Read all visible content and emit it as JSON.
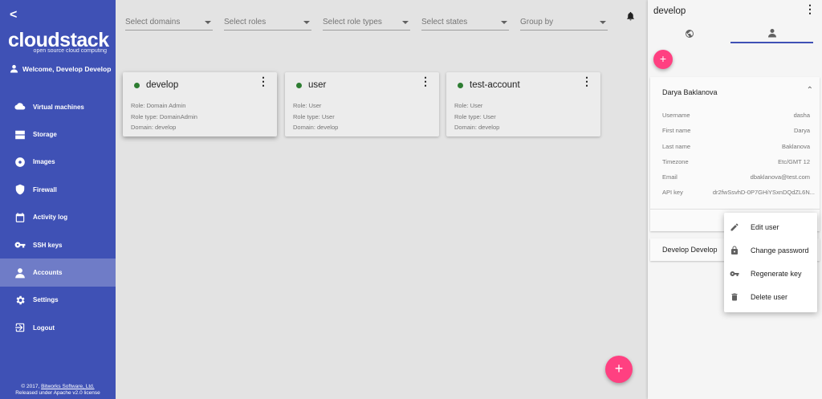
{
  "sidebar": {
    "logo_text": "cloudstack",
    "logo_tagline": "open source cloud computing",
    "welcome": "Welcome, Develop Develop",
    "items": [
      {
        "label": "Virtual machines",
        "icon": "cloud-icon"
      },
      {
        "label": "Storage",
        "icon": "storage-icon"
      },
      {
        "label": "Images",
        "icon": "disc-icon"
      },
      {
        "label": "Firewall",
        "icon": "shield-icon"
      },
      {
        "label": "Activity log",
        "icon": "calendar-icon"
      },
      {
        "label": "SSH keys",
        "icon": "key-icon"
      },
      {
        "label": "Accounts",
        "icon": "person-icon",
        "active": true
      },
      {
        "label": "Settings",
        "icon": "gear-icon"
      },
      {
        "label": "Logout",
        "icon": "logout-icon"
      }
    ],
    "footer_line1_prefix": "© 2017, ",
    "footer_company": "Bitworks Software, Ltd.",
    "footer_line2": "Released under Apache v2.0 license"
  },
  "filters": {
    "domains": "Select domains",
    "roles": "Select roles",
    "role_types": "Select role types",
    "states": "Select states",
    "group_by": "Group by"
  },
  "cards": [
    {
      "name": "develop",
      "role": "Role: Domain Admin",
      "role_type": "Role type: DomainAdmin",
      "domain": "Domain: develop",
      "status_color": "#2e7d32"
    },
    {
      "name": "user",
      "role": "Role: User",
      "role_type": "Role type: User",
      "domain": "Domain: develop",
      "status_color": "#2e7d32"
    },
    {
      "name": "test-account",
      "role": "Role: User",
      "role_type": "Role type: User",
      "domain": "Domain: develop",
      "status_color": "#2e7d32"
    }
  ],
  "fab_label": "+",
  "panel": {
    "title": "develop",
    "tabs": [
      {
        "icon": "globe-icon"
      },
      {
        "icon": "person-icon",
        "active": true
      }
    ],
    "add_label": "+",
    "user": {
      "full_name": "Darya Baklanova",
      "fields": [
        {
          "label": "Username",
          "value": "dasha"
        },
        {
          "label": "First name",
          "value": "Darya"
        },
        {
          "label": "Last name",
          "value": "Baklanova"
        },
        {
          "label": "Timezone",
          "value": "Etc/GMT 12"
        },
        {
          "label": "Email",
          "value": "dbaklanova@test.com"
        },
        {
          "label": "API key",
          "value": "dr2fwSsvhD-0P7GHiYSxnDQdZL6N..."
        }
      ]
    },
    "second_user": "Develop Develop"
  },
  "context_menu": [
    {
      "label": "Edit user",
      "icon": "pencil-icon"
    },
    {
      "label": "Change password",
      "icon": "lock-icon"
    },
    {
      "label": "Regenerate key",
      "icon": "key-icon"
    },
    {
      "label": "Delete user",
      "icon": "trash-icon"
    }
  ],
  "colors": {
    "primary": "#3f51b5",
    "accent": "#ff4081",
    "active_status": "#2e7d32"
  }
}
